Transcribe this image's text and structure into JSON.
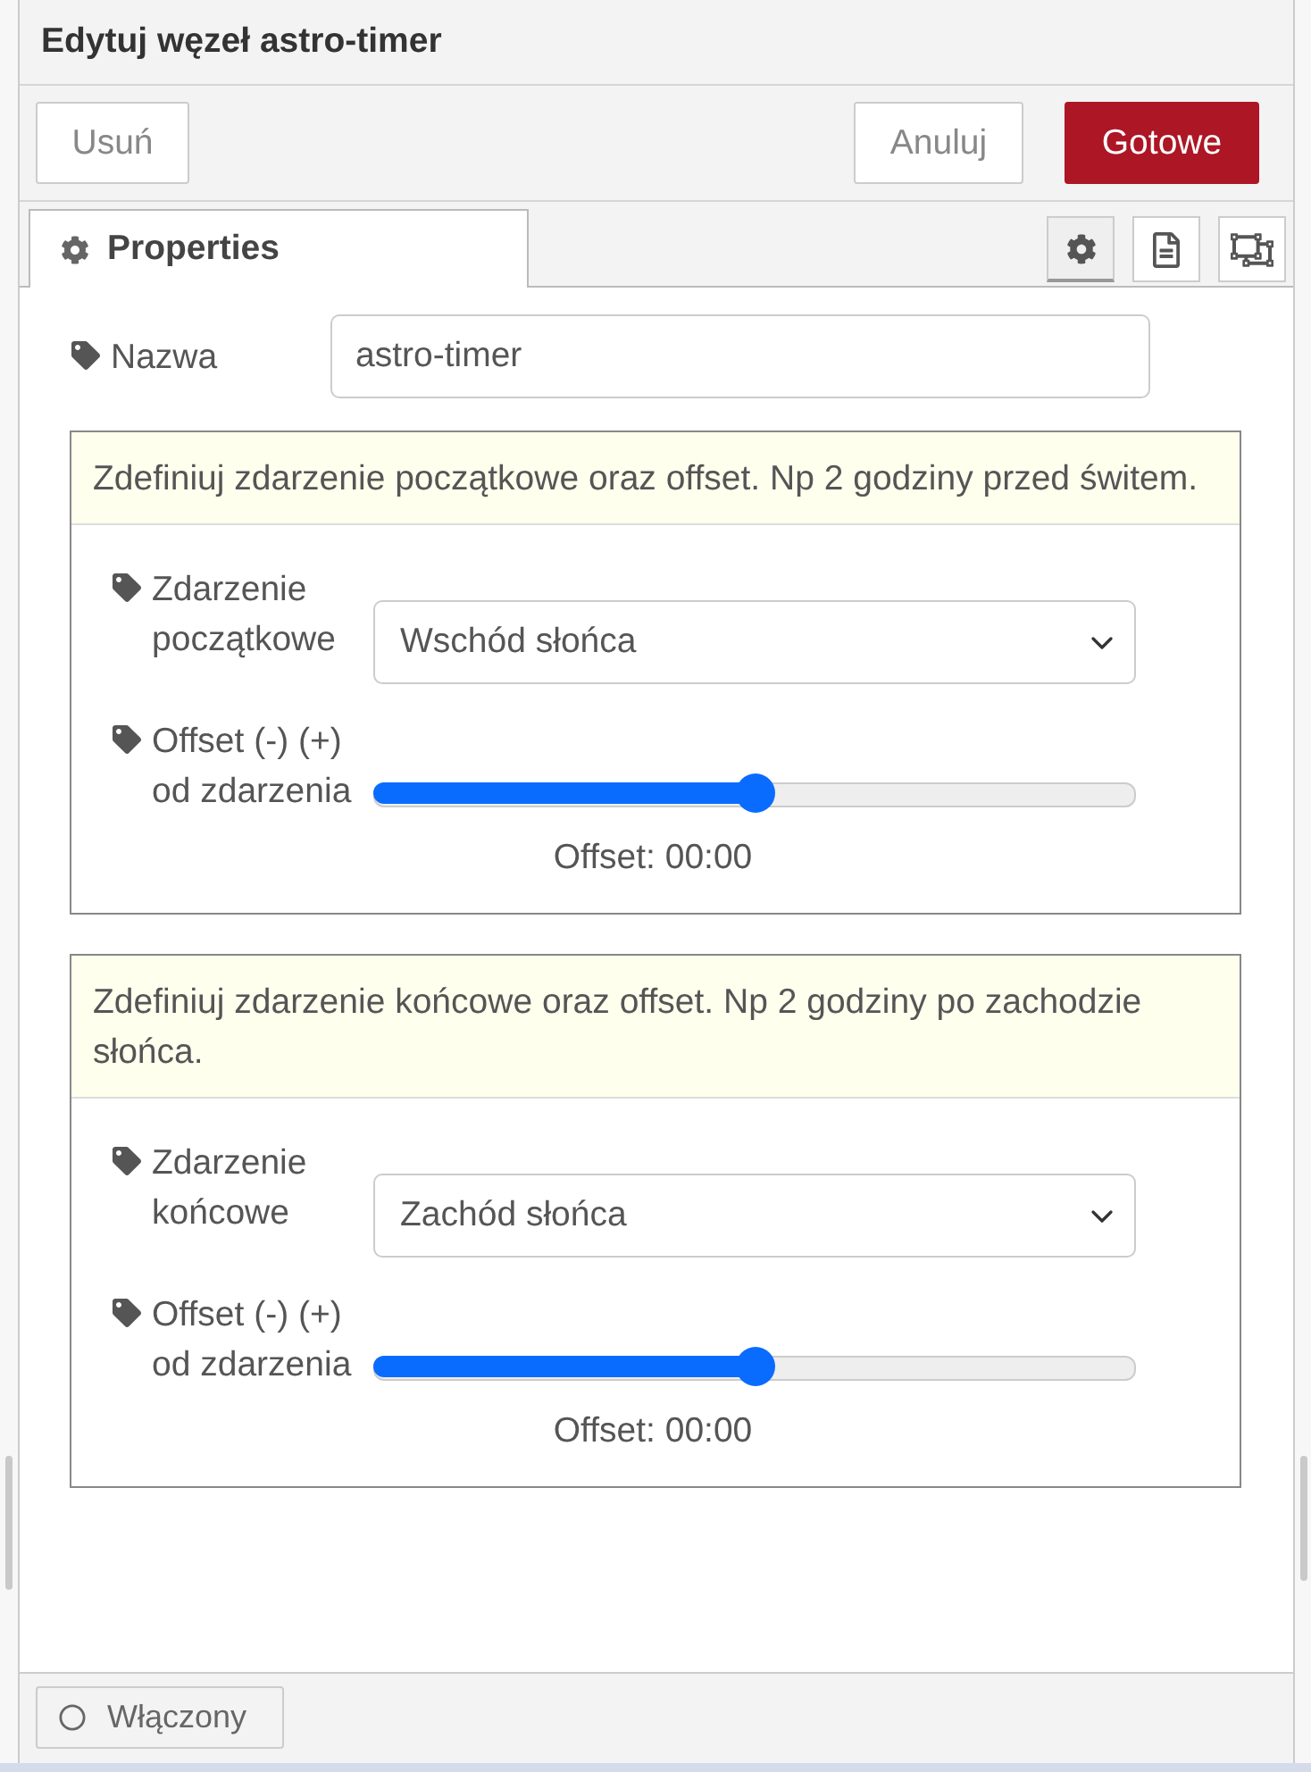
{
  "window": {
    "title": "Edytuj węzeł astro-timer"
  },
  "toolbar": {
    "left": [
      {
        "label": "Usuń",
        "kind": "delete"
      }
    ],
    "right": [
      {
        "label": "Anuluj",
        "kind": "cancel"
      },
      {
        "label": "Gotowe",
        "kind": "done"
      }
    ]
  },
  "tabs": [
    {
      "label": "Properties",
      "selected": true
    }
  ],
  "tab_buttons": [
    {
      "kind": "settings",
      "selected": true
    },
    {
      "kind": "description",
      "selected": false
    },
    {
      "kind": "appearance",
      "selected": false
    }
  ],
  "name_field": {
    "label": "Nazwa",
    "value": "astro-timer"
  },
  "sections": [
    {
      "hint": "Zdefiniuj zdarzenie początkowe oraz offset. Np 2 godziny przed świtem.",
      "event": {
        "label": "Zdarzenie początkowe",
        "value": "Wschód słońca"
      },
      "offset": {
        "label": "Offset (-) (+) od zdarzenia",
        "level": 0.5,
        "reading": "Offset: 00:00"
      }
    },
    {
      "hint": "Zdefiniuj zdarzenie końcowe oraz offset. Np 2 godziny po zachodzie słońca.",
      "event": {
        "label": "Zdarzenie końcowe",
        "value": "Zachód słońca"
      },
      "offset": {
        "label": "Offset (-) (+) od zdarzenia",
        "level": 0.5,
        "reading": "Offset: 00:00"
      }
    }
  ],
  "footer": {
    "toggle": {
      "label": "Włączony",
      "on": true
    }
  }
}
